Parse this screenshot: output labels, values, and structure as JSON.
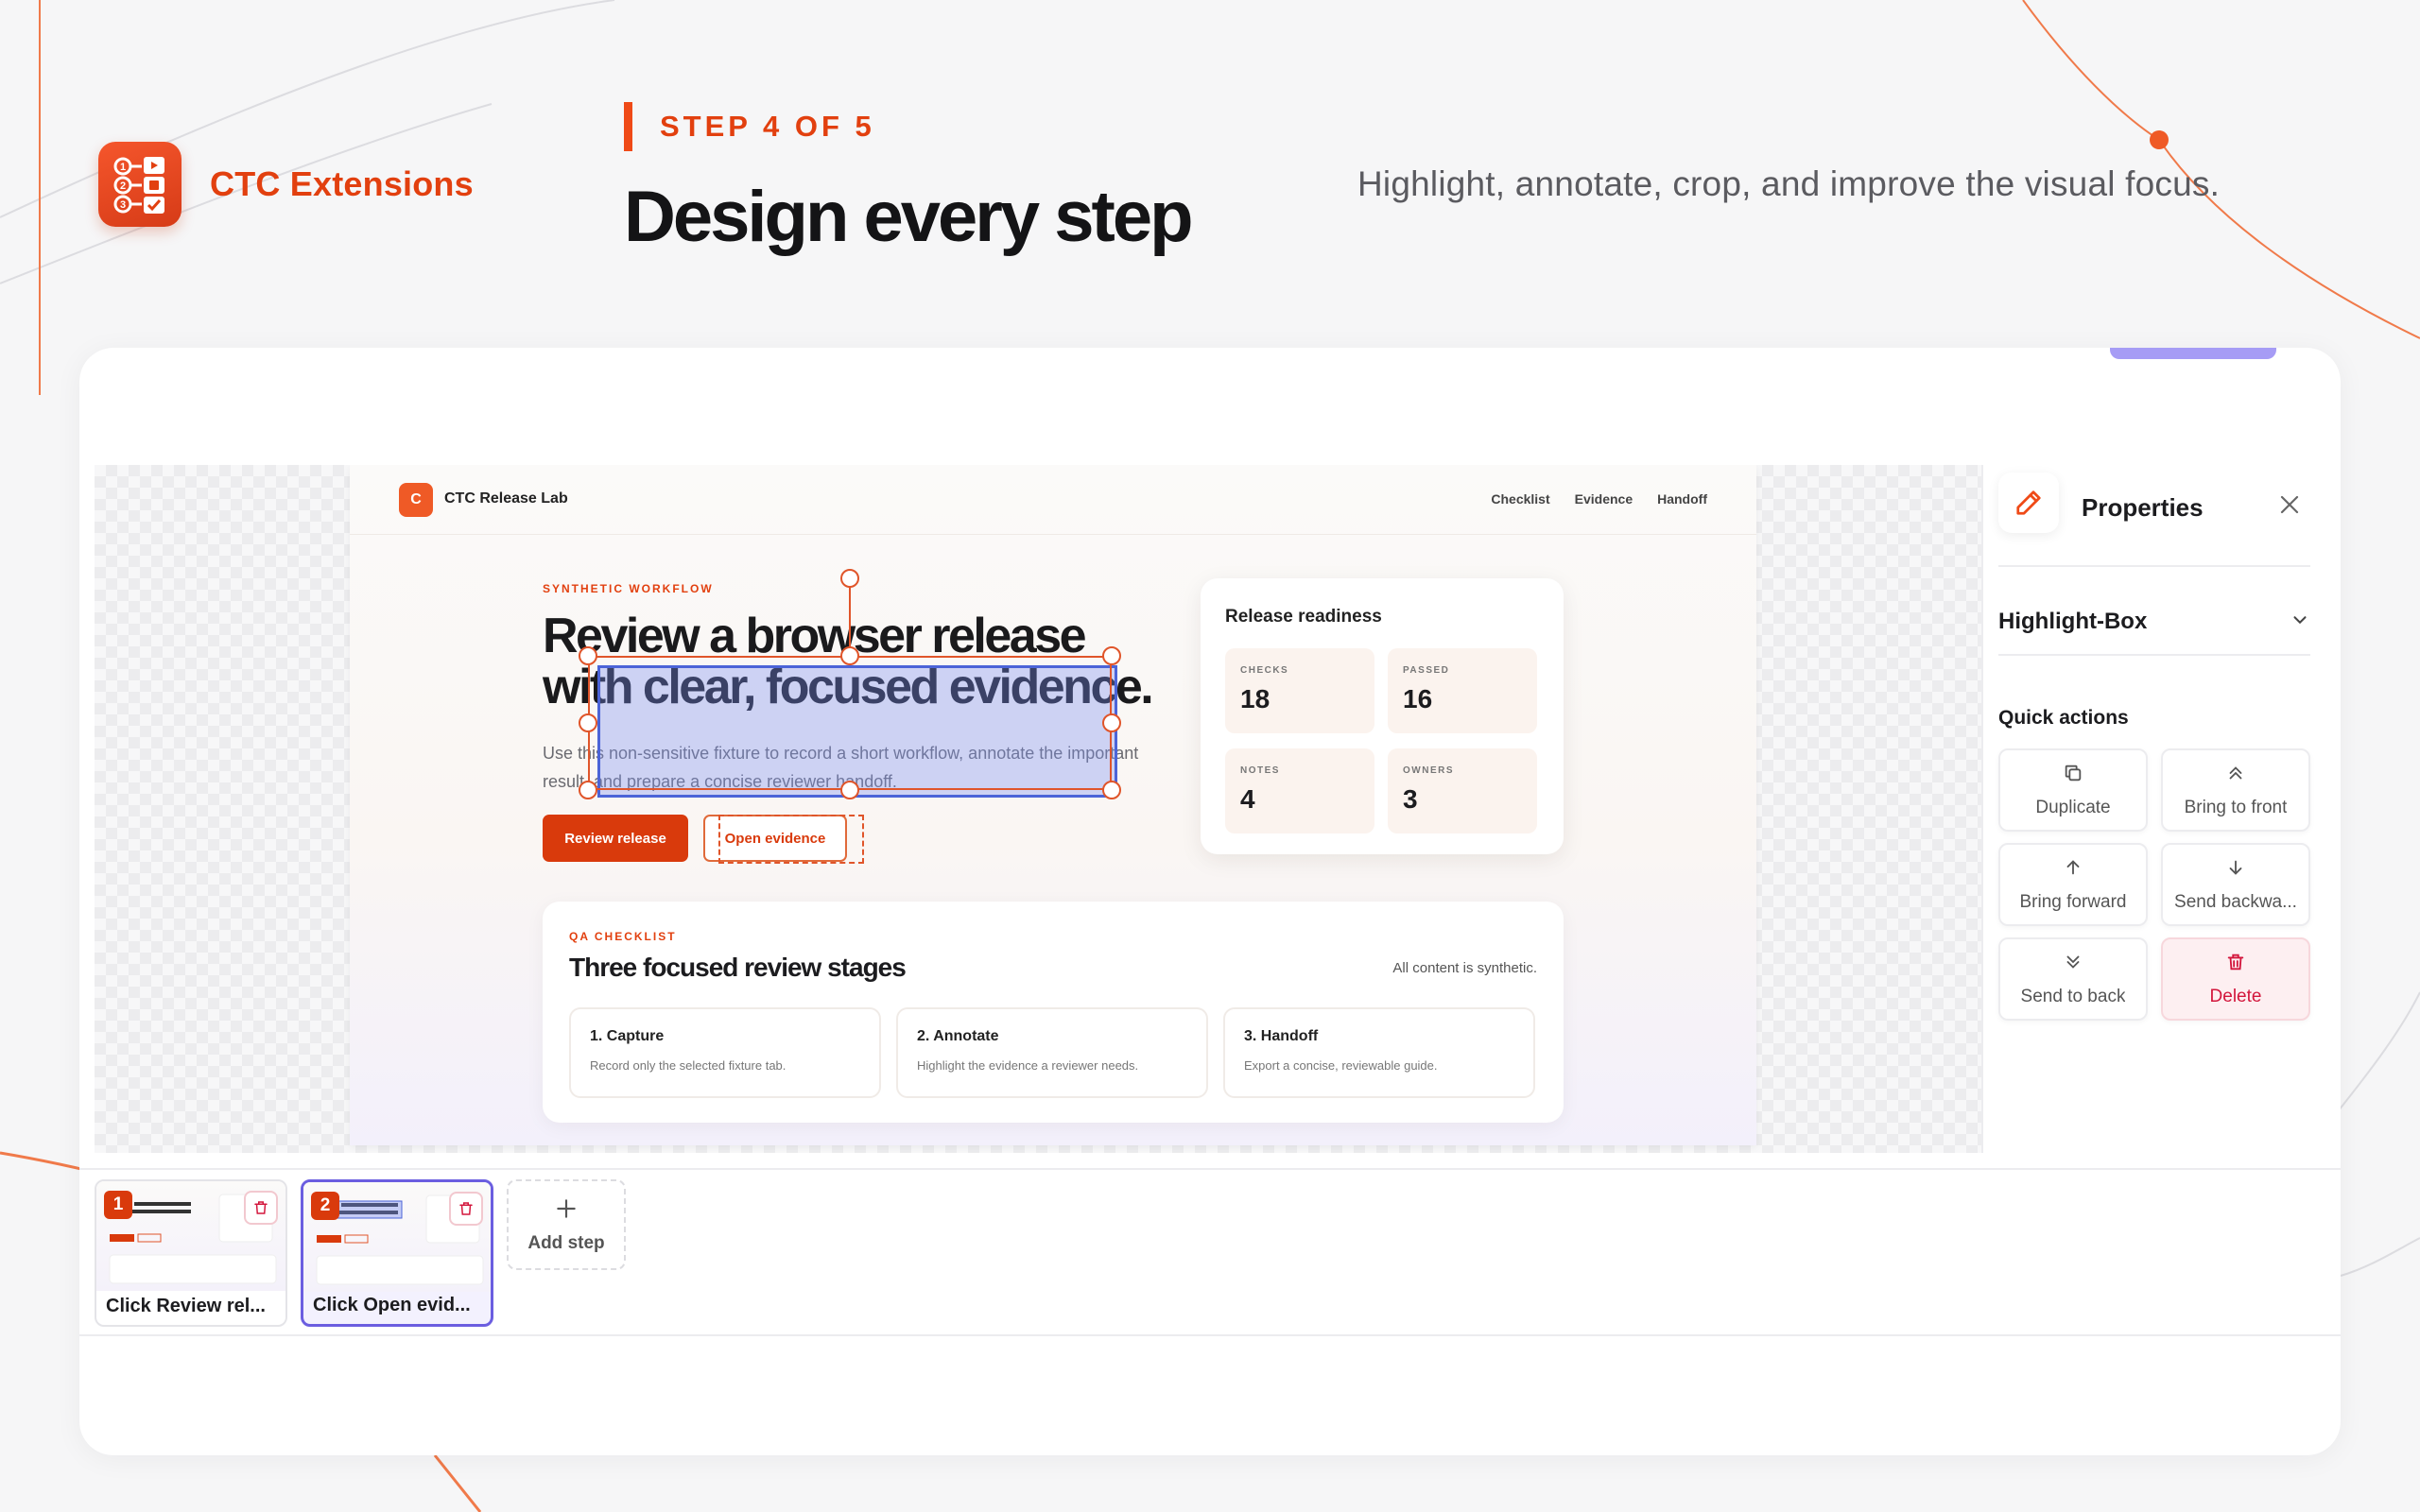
{
  "brand": {
    "name": "CTC Extensions"
  },
  "header": {
    "step_label": "STEP 4 OF 5",
    "title": "Design every step",
    "subtitle": "Highlight, annotate, crop, and improve the visual focus."
  },
  "screenshot": {
    "logo_letter": "C",
    "brand": "CTC Release Lab",
    "nav_links": [
      "Checklist",
      "Evidence",
      "Handoff"
    ],
    "eyebrow": "SYNTHETIC WORKFLOW",
    "headline_line1": "Review a browser release",
    "headline_line2": "with clear, focused evidence.",
    "paragraph": "Use this non-sensitive fixture to record a short workflow, annotate the important result, and prepare a concise reviewer handoff.",
    "primary_button": "Review release",
    "secondary_button": "Open evidence",
    "readiness": {
      "title": "Release readiness",
      "stats": [
        {
          "label": "CHECKS",
          "value": "18"
        },
        {
          "label": "PASSED",
          "value": "16"
        },
        {
          "label": "NOTES",
          "value": "4"
        },
        {
          "label": "OWNERS",
          "value": "3"
        }
      ]
    },
    "qa": {
      "eyebrow": "QA CHECKLIST",
      "title": "Three focused review stages",
      "note": "All content is synthetic.",
      "items": [
        {
          "title": "1. Capture",
          "desc": "Record only the selected fixture tab."
        },
        {
          "title": "2. Annotate",
          "desc": "Highlight the evidence a reviewer needs."
        },
        {
          "title": "3. Handoff",
          "desc": "Export a concise, reviewable guide."
        }
      ]
    }
  },
  "properties": {
    "title": "Properties",
    "element_type": "Highlight-Box",
    "quick_actions_label": "Quick actions",
    "actions": {
      "duplicate": "Duplicate",
      "bring_to_front": "Bring to front",
      "bring_forward": "Bring forward",
      "send_backward": "Send backwa...",
      "send_to_back": "Send to back",
      "delete": "Delete"
    }
  },
  "filmstrip": {
    "steps": [
      {
        "number": "1",
        "label": "Click Review rel..."
      },
      {
        "number": "2",
        "label": "Click Open evid..."
      }
    ],
    "add_step": "Add step"
  },
  "colors": {
    "accent": "#e2400f",
    "highlight_fill": "#788cf0",
    "highlight_border": "#4b64d8",
    "active_step": "#6b5ee0",
    "danger": "#d3163c"
  }
}
